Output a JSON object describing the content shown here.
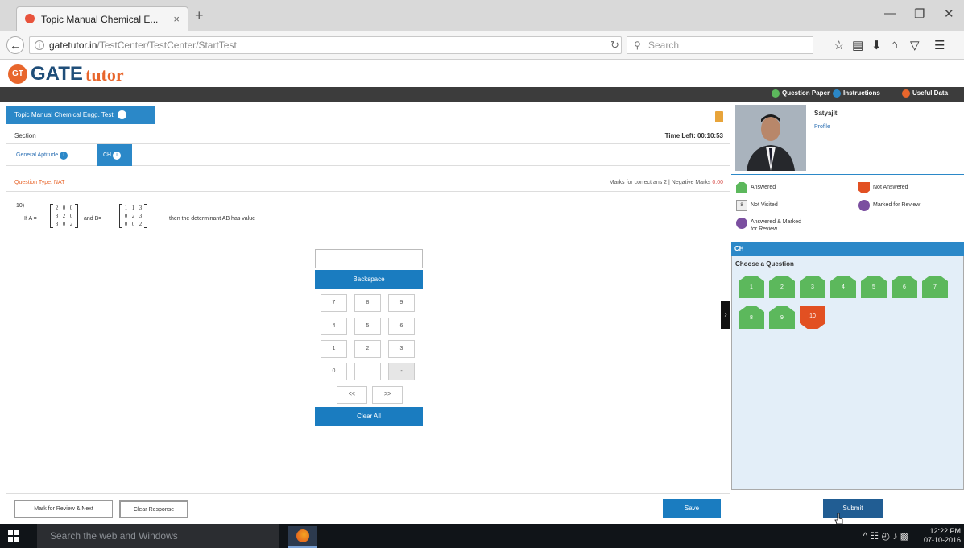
{
  "browser": {
    "tab_title": "Topic Manual Chemical E...",
    "tab_close": "×",
    "new_tab": "+",
    "url_domain": "gatetutor.in",
    "url_path": "/TestCenter/TestCenter/StartTest",
    "search_placeholder": "Search",
    "window_controls": {
      "minimize": "—",
      "restore": "❐",
      "close": "✕"
    }
  },
  "site": {
    "logo_badge": "GT",
    "logo_gate": "GATE",
    "logo_tutor": "tutor",
    "header_links": [
      {
        "label": "Question Paper",
        "color": "#5cb85c"
      },
      {
        "label": "Instructions",
        "color": "#2b88c8"
      },
      {
        "label": "Useful Data",
        "color": "#e8662c"
      }
    ]
  },
  "test": {
    "title": "Topic Manual Chemical Engg. Test",
    "section_label": "Section",
    "time_left": "Time Left: 00:10:53",
    "sections": [
      "General Aptitude",
      "CH"
    ],
    "question_type": "Question Type: NAT",
    "marks_correct_text": "Marks for correct ans 2 | Negative Marks",
    "negative_marks": "0.00",
    "question_number": "10)",
    "question_prefix": "If A =",
    "question_and": "and B=",
    "question_suffix": "then the determinant AB has value",
    "matrix_a": [
      [
        "2",
        "0",
        "0"
      ],
      [
        "8",
        "2",
        "0"
      ],
      [
        "8",
        "0",
        "2"
      ]
    ],
    "matrix_b": [
      [
        "1",
        "1",
        "3"
      ],
      [
        "0",
        "2",
        "3"
      ],
      [
        "0",
        "0",
        "2"
      ]
    ]
  },
  "keypad": {
    "backspace": "Backspace",
    "keys": [
      "7",
      "8",
      "9",
      "4",
      "5",
      "6",
      "1",
      "2",
      "3",
      "0",
      ".",
      "-"
    ],
    "left_arrow": "<<",
    "right_arrow": ">>",
    "clear_all": "Clear All"
  },
  "profile": {
    "name": "Satyajit",
    "link": "Profile"
  },
  "legend": {
    "answered": "Answered",
    "not_answered": "Not Answered",
    "not_visited": "Not Visited",
    "marked_review": "Marked for Review",
    "answered_marked": "Answered & Marked for Review",
    "not_visited_num": "8",
    "colors": {
      "answered": "#5cb85c",
      "not_answered": "#e25022",
      "not_visited": "#eeeeee",
      "marked": "#7b4fa0"
    }
  },
  "palette": {
    "section": "CH",
    "choose_label": "Choose a Question",
    "questions": [
      {
        "n": "1",
        "status": "answered"
      },
      {
        "n": "2",
        "status": "answered"
      },
      {
        "n": "3",
        "status": "answered"
      },
      {
        "n": "4",
        "status": "answered"
      },
      {
        "n": "5",
        "status": "answered"
      },
      {
        "n": "6",
        "status": "answered"
      },
      {
        "n": "7",
        "status": "answered"
      },
      {
        "n": "8",
        "status": "answered"
      },
      {
        "n": "9",
        "status": "answered"
      },
      {
        "n": "10",
        "status": "not_answered"
      }
    ]
  },
  "actions": {
    "mark_review_next": "Mark for Review & Next",
    "clear_response": "Clear Response",
    "save": "Save",
    "submit": "Submit"
  },
  "taskbar": {
    "search_placeholder": "Search the web and Windows",
    "time": "12:22 PM",
    "date": "07-10-2016"
  }
}
